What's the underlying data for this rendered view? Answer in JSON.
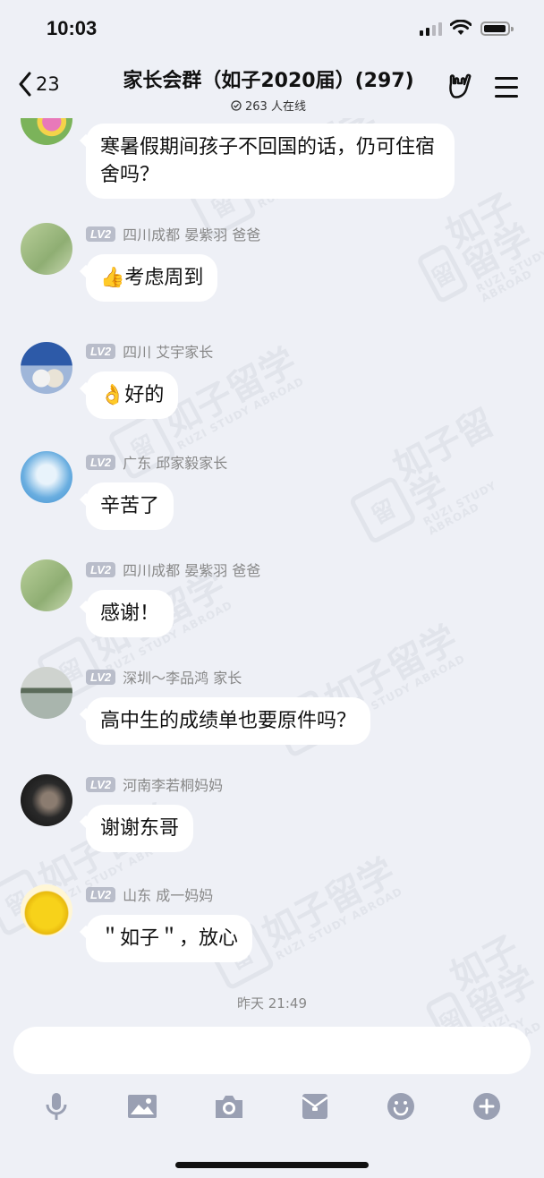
{
  "status": {
    "time": "10:03"
  },
  "header": {
    "back_count": "23",
    "title": "家长会群（如子2020届）(297)",
    "online": "263 人在线"
  },
  "messages": [
    {
      "level": "",
      "sender": "",
      "text": "寒暑假期间孩子不回国的话，仍可住宿舍吗？",
      "avatar": "flower"
    },
    {
      "level": "LV2",
      "sender": "四川成都 晏紫羽 爸爸",
      "text": "考虑周到",
      "emoji": "👍",
      "avatar": "leaf"
    },
    {
      "level": "LV2",
      "sender": "四川 艾宇家长",
      "text": "好的",
      "emoji": "👌",
      "avatar": "cats"
    },
    {
      "level": "LV2",
      "sender": "广东 邱家毅家长",
      "text": "辛苦了",
      "avatar": "sky"
    },
    {
      "level": "LV2",
      "sender": "四川成都 晏紫羽 爸爸",
      "text": "感谢！",
      "avatar": "leaf"
    },
    {
      "level": "LV2",
      "sender": "深圳～李品鸿 家长",
      "text": "高中生的成绩单也要原件吗？",
      "avatar": "lake"
    },
    {
      "level": "LV2",
      "sender": "河南李若桐妈妈",
      "text": "谢谢东哥",
      "avatar": "portrait"
    },
    {
      "level": "LV2",
      "sender": "山东 成一妈妈",
      "text": "＂如子＂，放心",
      "avatar": "duck"
    }
  ],
  "timestamp": "昨天 21:49",
  "watermark": {
    "cn": "如子留学",
    "en": "RUZI STUDY ABROAD",
    "badge": "留"
  },
  "toolbar": {
    "icons": [
      "microphone-icon",
      "image-icon",
      "camera-icon",
      "red-packet-icon",
      "emoji-icon",
      "plus-icon"
    ]
  },
  "colors": {
    "background": "#eef0f6",
    "bubble": "#ffffff",
    "level_badge": "#b9bdca"
  }
}
